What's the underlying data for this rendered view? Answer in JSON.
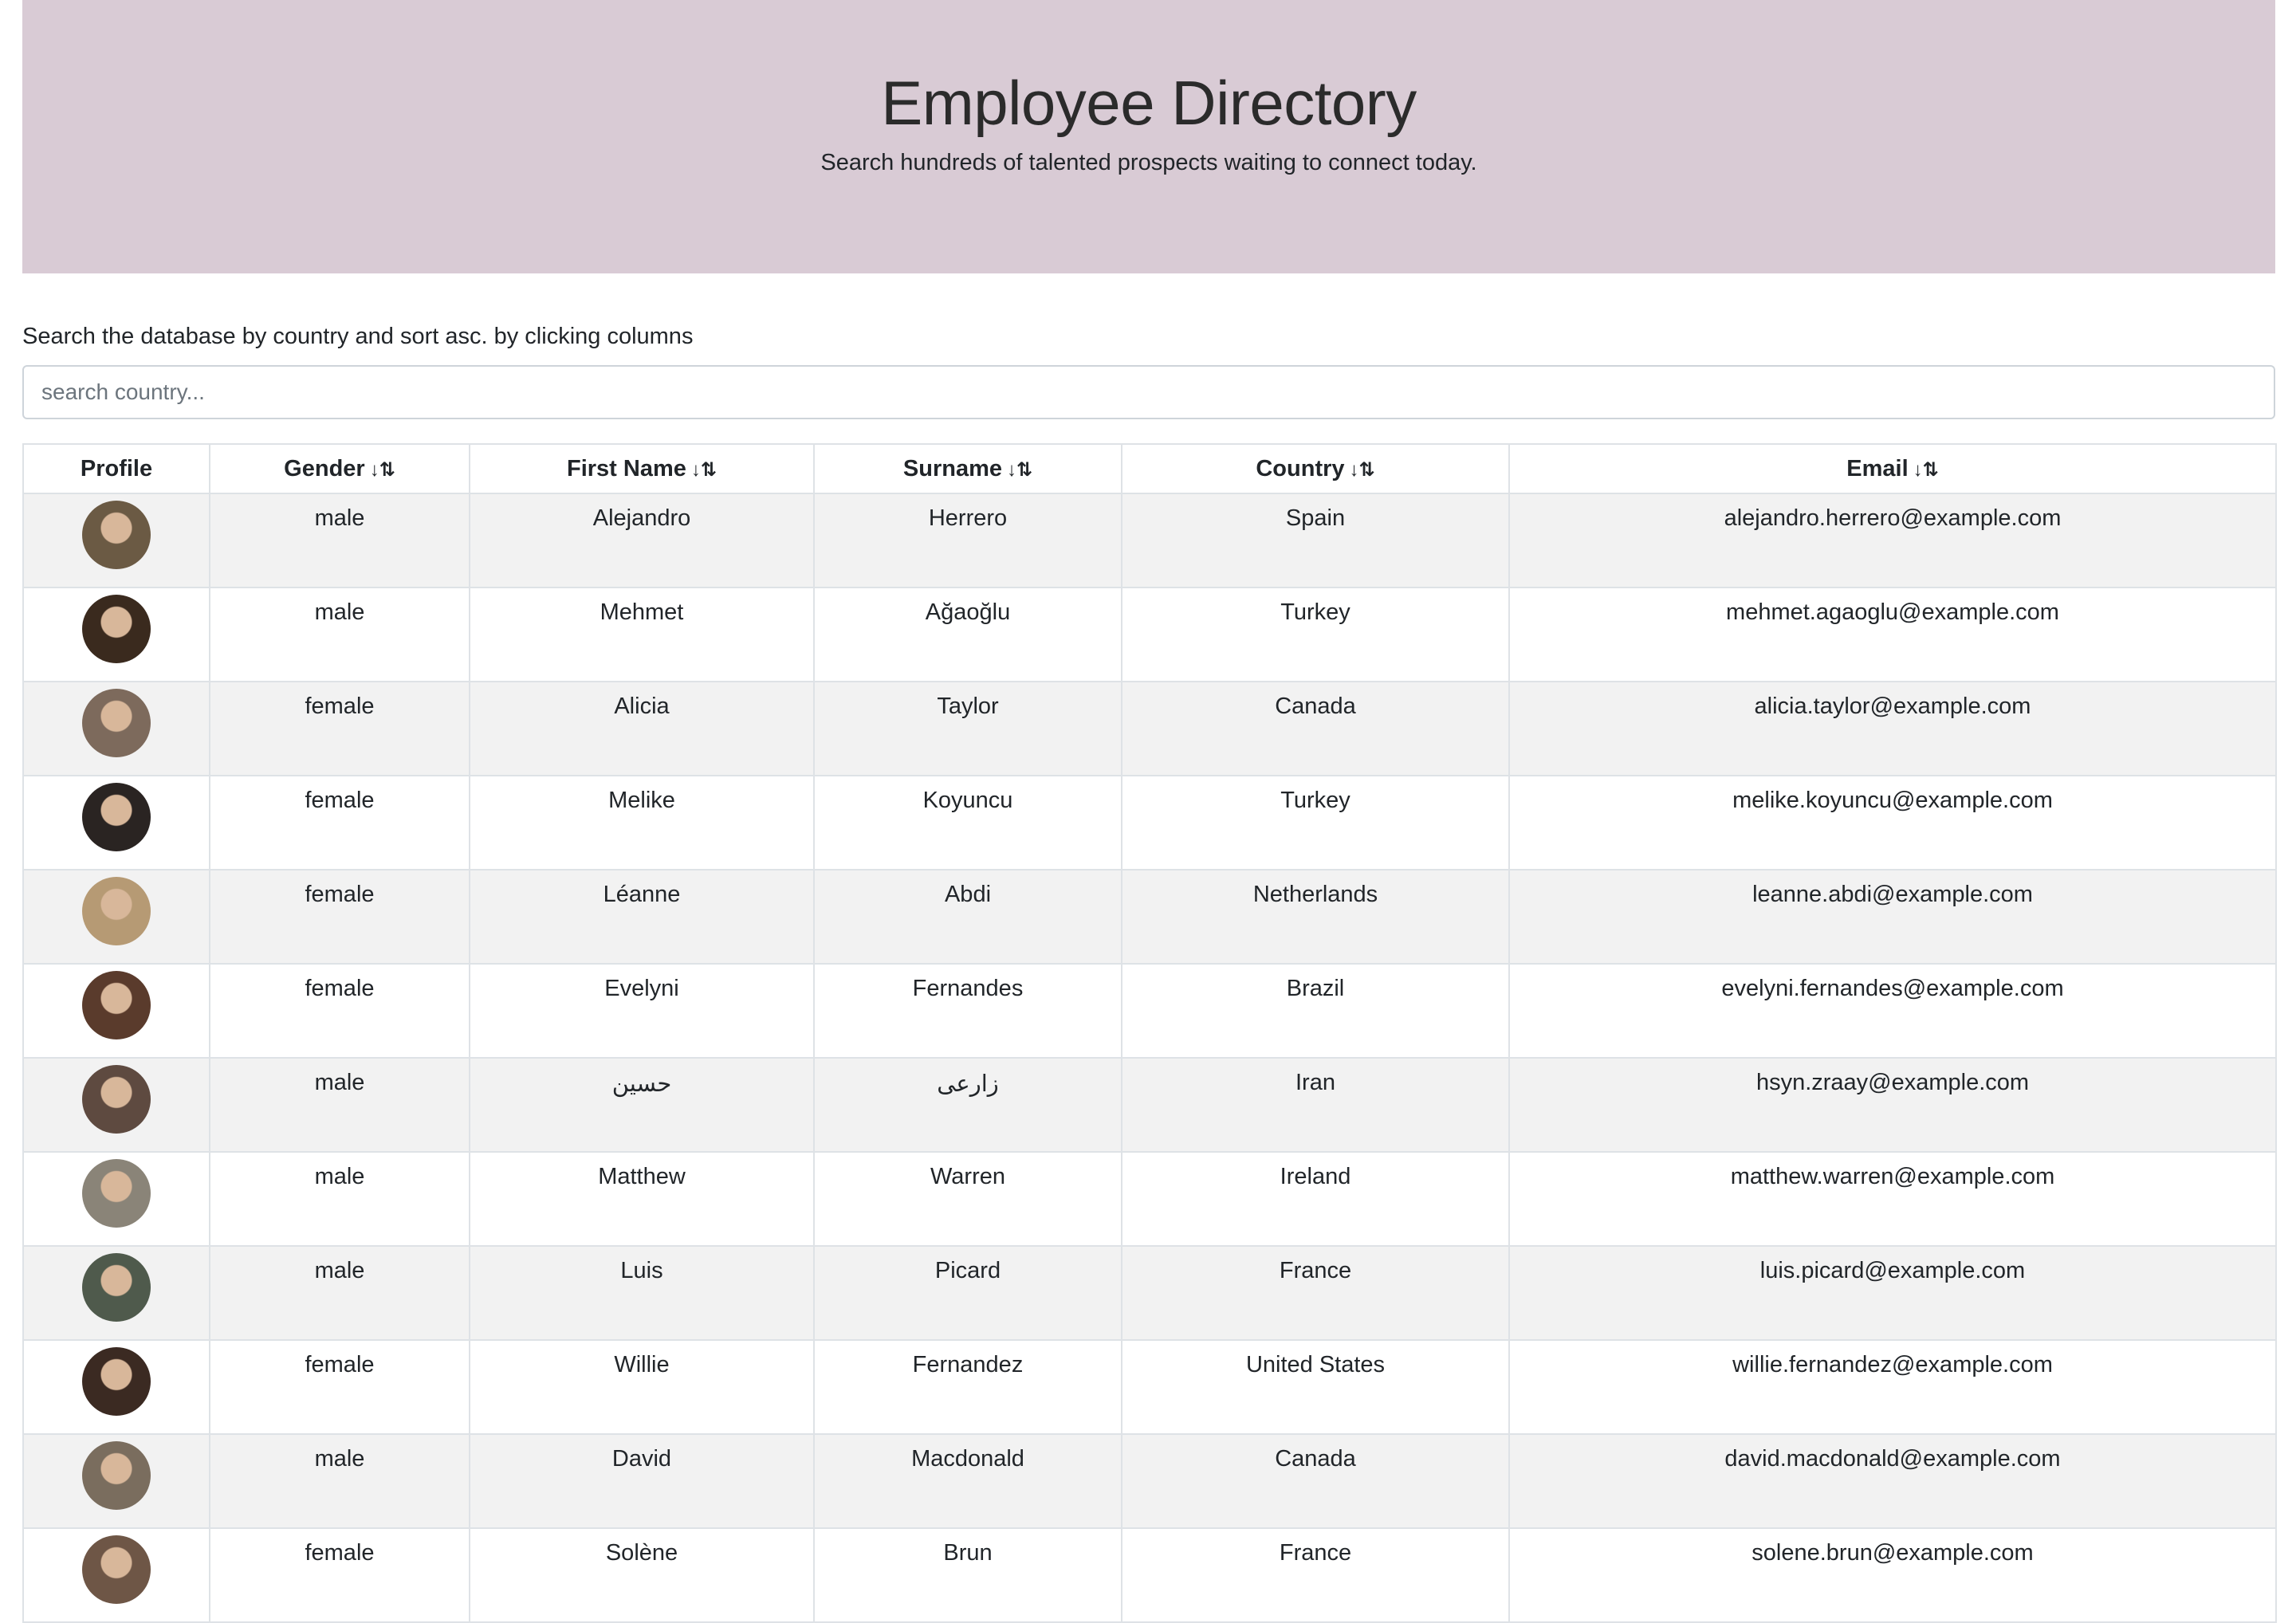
{
  "header": {
    "title": "Employee Directory",
    "subtitle": "Search hundreds of talented prospects waiting to connect today."
  },
  "search": {
    "instructions": "Search the database by country and sort asc. by clicking columns",
    "placeholder": "search country..."
  },
  "table": {
    "columns": [
      {
        "label": "Profile",
        "sortable": false
      },
      {
        "label": "Gender",
        "sortable": true
      },
      {
        "label": "First Name",
        "sortable": true
      },
      {
        "label": "Surname",
        "sortable": true
      },
      {
        "label": "Country",
        "sortable": true
      },
      {
        "label": "Email",
        "sortable": true
      }
    ],
    "sort_icon": "↓⇅",
    "rows": [
      {
        "gender": "male",
        "first": "Alejandro",
        "last": "Herrero",
        "country": "Spain",
        "email": "alejandro.herrero@example.com",
        "avatar": "#6b5a44"
      },
      {
        "gender": "male",
        "first": "Mehmet",
        "last": "Ağaoğlu",
        "country": "Turkey",
        "email": "mehmet.agaoglu@example.com",
        "avatar": "#3a2a1e"
      },
      {
        "gender": "female",
        "first": "Alicia",
        "last": "Taylor",
        "country": "Canada",
        "email": "alicia.taylor@example.com",
        "avatar": "#7d6a5c"
      },
      {
        "gender": "female",
        "first": "Melike",
        "last": "Koyuncu",
        "country": "Turkey",
        "email": "melike.koyuncu@example.com",
        "avatar": "#2a2422"
      },
      {
        "gender": "female",
        "first": "Léanne",
        "last": "Abdi",
        "country": "Netherlands",
        "email": "leanne.abdi@example.com",
        "avatar": "#b69a74"
      },
      {
        "gender": "female",
        "first": "Evelyni",
        "last": "Fernandes",
        "country": "Brazil",
        "email": "evelyni.fernandes@example.com",
        "avatar": "#5a3b2c"
      },
      {
        "gender": "male",
        "first": "حسین",
        "last": "زارعی",
        "country": "Iran",
        "email": "hsyn.zraay@example.com",
        "avatar": "#5e4a40"
      },
      {
        "gender": "male",
        "first": "Matthew",
        "last": "Warren",
        "country": "Ireland",
        "email": "matthew.warren@example.com",
        "avatar": "#8a8478"
      },
      {
        "gender": "male",
        "first": "Luis",
        "last": "Picard",
        "country": "France",
        "email": "luis.picard@example.com",
        "avatar": "#4f5a4c"
      },
      {
        "gender": "female",
        "first": "Willie",
        "last": "Fernandez",
        "country": "United States",
        "email": "willie.fernandez@example.com",
        "avatar": "#3b2a22"
      },
      {
        "gender": "male",
        "first": "David",
        "last": "Macdonald",
        "country": "Canada",
        "email": "david.macdonald@example.com",
        "avatar": "#7a6d5e"
      },
      {
        "gender": "female",
        "first": "Solène",
        "last": "Brun",
        "country": "France",
        "email": "solene.brun@example.com",
        "avatar": "#6e5646"
      }
    ]
  }
}
